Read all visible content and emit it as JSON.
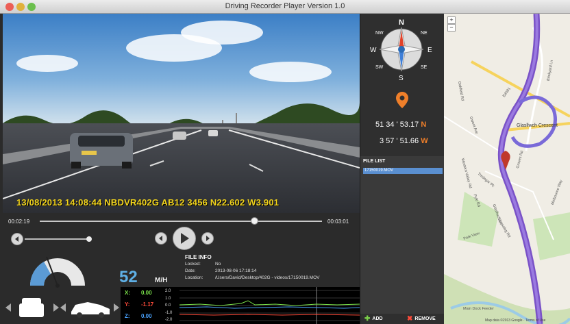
{
  "window": {
    "title": "Driving Recorder Player Version 1.0",
    "traffic_lights": [
      "#ec5f57",
      "#e0b13c",
      "#6bbf4d"
    ]
  },
  "video": {
    "osd_text": "13/08/2013  14:08:44  NBDVR402G  AB12 3456  N22.602  W3.901"
  },
  "playback": {
    "current_time": "00:02:19",
    "total_time": "00:03:01",
    "progress": 0.77,
    "volume_level": 0.0
  },
  "speed": {
    "value": "52",
    "unit": "M/H"
  },
  "file_info": {
    "title": "FILE INFO",
    "locked_label": "Locked:",
    "locked_value": "No",
    "date_label": "Date:",
    "date_value": "2013-08-06 17:18:14",
    "location_label": "Location:",
    "location_value": "/Users/David/Desktop/402G - videos/17150019.MOV"
  },
  "accelerometer": {
    "x_label": "X:",
    "x_value": "0.00",
    "x_color": "#7be34b",
    "y_label": "Y:",
    "y_value": "-1.17",
    "y_color": "#ff4b3a",
    "z_label": "Z:",
    "z_value": "0.00",
    "z_color": "#4aa3ff",
    "ticks": [
      "2.0",
      "1.0",
      "0.0",
      "-1.0",
      "-2.0"
    ]
  },
  "gps": {
    "lat": "51 34 ' 53.17",
    "lat_hemi": "N",
    "lon": "3 57 ' 51.66",
    "lon_hemi": "W"
  },
  "compass": {
    "labels": [
      "N",
      "E",
      "S",
      "W",
      "NE",
      "SE",
      "SW",
      "NW"
    ]
  },
  "file_list": {
    "title": "FILE LIST",
    "items": [
      "17150019.MOV"
    ],
    "add_label": "ADD",
    "remove_label": "REMOVE"
  },
  "map": {
    "labels": [
      "B4591",
      "Glasllwch Crescent",
      "Brickyard Ln",
      "Gwent Ave",
      "Tredegar Pk",
      "Pyle Rd",
      "Bassaleg Rd",
      "Park View",
      "Melbourne Way",
      "Main Dock Feeder",
      "Glasllwch Ln",
      "Groves Rd",
      "Oakfield Rd",
      "Western Valley Rd"
    ],
    "attribution": "Map data ©2013 Google · Terms of Use",
    "zoom_in": "+",
    "zoom_out": "−"
  }
}
